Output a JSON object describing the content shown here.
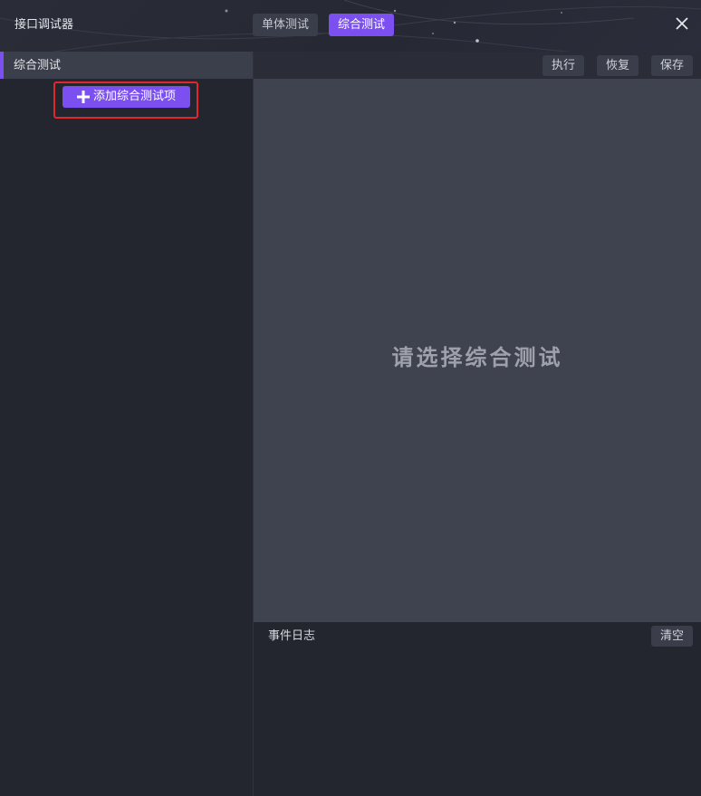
{
  "app": {
    "title": "接口调试器"
  },
  "tabs": [
    {
      "label": "单体测试",
      "active": false
    },
    {
      "label": "综合测试",
      "active": true
    }
  ],
  "left_panel": {
    "header": "综合测试",
    "add_button": "添加综合测试项",
    "add_icon": "plus-icon"
  },
  "toolbar": {
    "execute": "执行",
    "restore": "恢复",
    "save": "保存"
  },
  "canvas": {
    "placeholder": "请选择综合测试"
  },
  "event_log": {
    "title": "事件日志",
    "clear": "清空"
  },
  "colors": {
    "accent": "#7b4ff0",
    "highlight_border": "#e0282a",
    "background": "#23252f",
    "canvas": "#3f424f"
  }
}
